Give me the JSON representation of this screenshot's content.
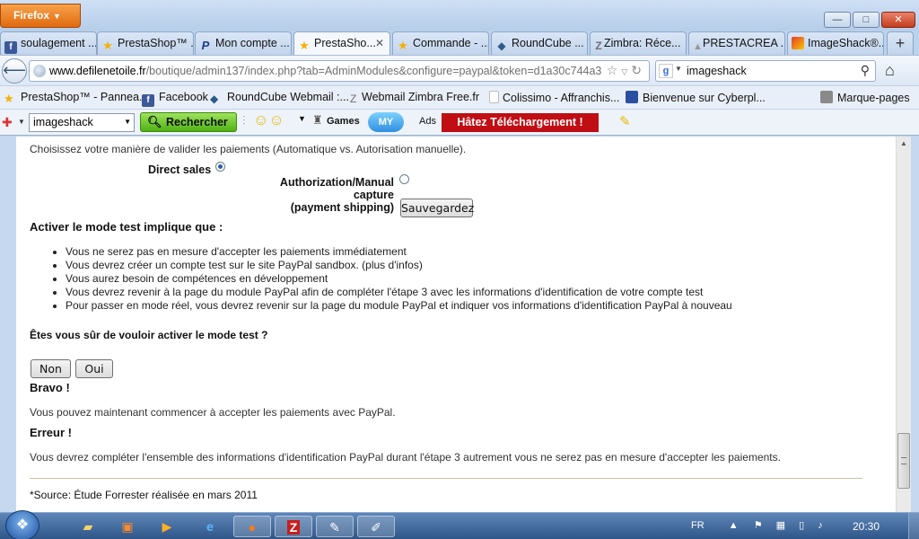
{
  "window": {
    "app_button": "Firefox",
    "controls": {
      "minimize": "—",
      "maximize": "□",
      "close": "✕"
    }
  },
  "tabs": [
    {
      "label": "soulagement ...",
      "icon": "facebook-icon",
      "color": "#3b5998",
      "glyph": "f"
    },
    {
      "label": "PrestaShop™ ...",
      "icon": "star-icon",
      "color": "#f5b000",
      "glyph": "★"
    },
    {
      "label": "Mon compte ...",
      "icon": "paypal-icon",
      "color": "#1b3d8f",
      "glyph": "P"
    },
    {
      "label": "PrestaSho...",
      "icon": "star-icon",
      "color": "#f5b000",
      "glyph": "★",
      "active": true
    },
    {
      "label": "Commande - ...",
      "icon": "star-icon",
      "color": "#f5b000",
      "glyph": "★"
    },
    {
      "label": "RoundCube ...",
      "icon": "roundcube-icon",
      "color": "#2c5a8a",
      "glyph": "◆"
    },
    {
      "label": "Zimbra: Réce...",
      "icon": "zimbra-icon",
      "color": "#6e6e6e",
      "glyph": "Z"
    },
    {
      "label": "PRESTACREA ...",
      "icon": "prestacrea-icon",
      "color": "#999999",
      "glyph": "▲"
    },
    {
      "label": "ImageShack®...",
      "icon": "imageshack-icon",
      "color": "#c8a400",
      "glyph": "◢"
    }
  ],
  "new_tab": "+",
  "nav": {
    "url_domain": "www.defilenetoile.fr",
    "url_path": "/boutique/admin137/index.php?tab=AdminModules&configure=paypal&token=d1a30c744a3",
    "search_value": "imageshack",
    "search_engine": "g"
  },
  "bookmarks": [
    {
      "label": "PrestaShop™ - Pannea...",
      "icon": "star-icon",
      "color": "#f5b000"
    },
    {
      "label": "Facebook",
      "icon": "facebook-icon",
      "color": "#3b5998"
    },
    {
      "label": "RoundCube Webmail :...",
      "icon": "roundcube-icon",
      "color": "#2c5a8a"
    },
    {
      "label": "Webmail Zimbra Free.fr",
      "icon": "zimbra-icon",
      "color": "#6e6e6e"
    },
    {
      "label": "Colissimo - Affranchis...",
      "icon": "page-icon",
      "color": "#dddddd"
    },
    {
      "label": "Bienvenue sur Cyberpl...",
      "icon": "cyberplus-icon",
      "color": "#2a4fa0"
    }
  ],
  "bookmarks_menu": "Marque-pages",
  "toolbar": {
    "combo_value": "imageshack",
    "search_button": "Rechercher",
    "games": "Games",
    "ads": "Ads",
    "promo": "Hâtez Téléchargement !"
  },
  "page": {
    "intro": "Choisissez votre manière de valider les paiements (Automatique vs. Autorisation manuelle).",
    "direct_sales": "Direct sales",
    "manual_capture_line1": "Authorization/Manual capture",
    "manual_capture_line2": "(payment shipping)",
    "save_button": "Sauvegardez",
    "test_heading": "Activer le mode test implique que :",
    "test_items": [
      "Vous ne serez pas en mesure d'accepter les paiements immédiatement",
      "Vous devrez créer un compte test sur le site PayPal sandbox. (plus d'infos)",
      "Vous aurez besoin de compétences en développement",
      "Vous devrez revenir à la page du module PayPal afin de compléter l'étape 3 avec les informations d'identification de votre compte test",
      "Pour passer en mode réel, vous devrez revenir sur la page du module PayPal et indiquer vos informations d'identification PayPal à nouveau"
    ],
    "confirm_question": "Êtes vous sûr de vouloir activer le mode test ?",
    "no_button": "Non",
    "yes_button": "Oui",
    "bravo_heading": "Bravo !",
    "bravo_text": "Vous pouvez maintenant commencer à accepter les paiements avec PayPal.",
    "error_heading": "Erreur !",
    "error_text": "Vous devrez compléter l'ensemble des informations d'identification PayPal durant l'étape 3 autrement vous ne serez pas en mesure d'accepter les paiements.",
    "source_note": "*Source: Étude Forrester réalisée en mars 2011"
  },
  "taskbar": {
    "language": "FR",
    "time": "20:30"
  }
}
